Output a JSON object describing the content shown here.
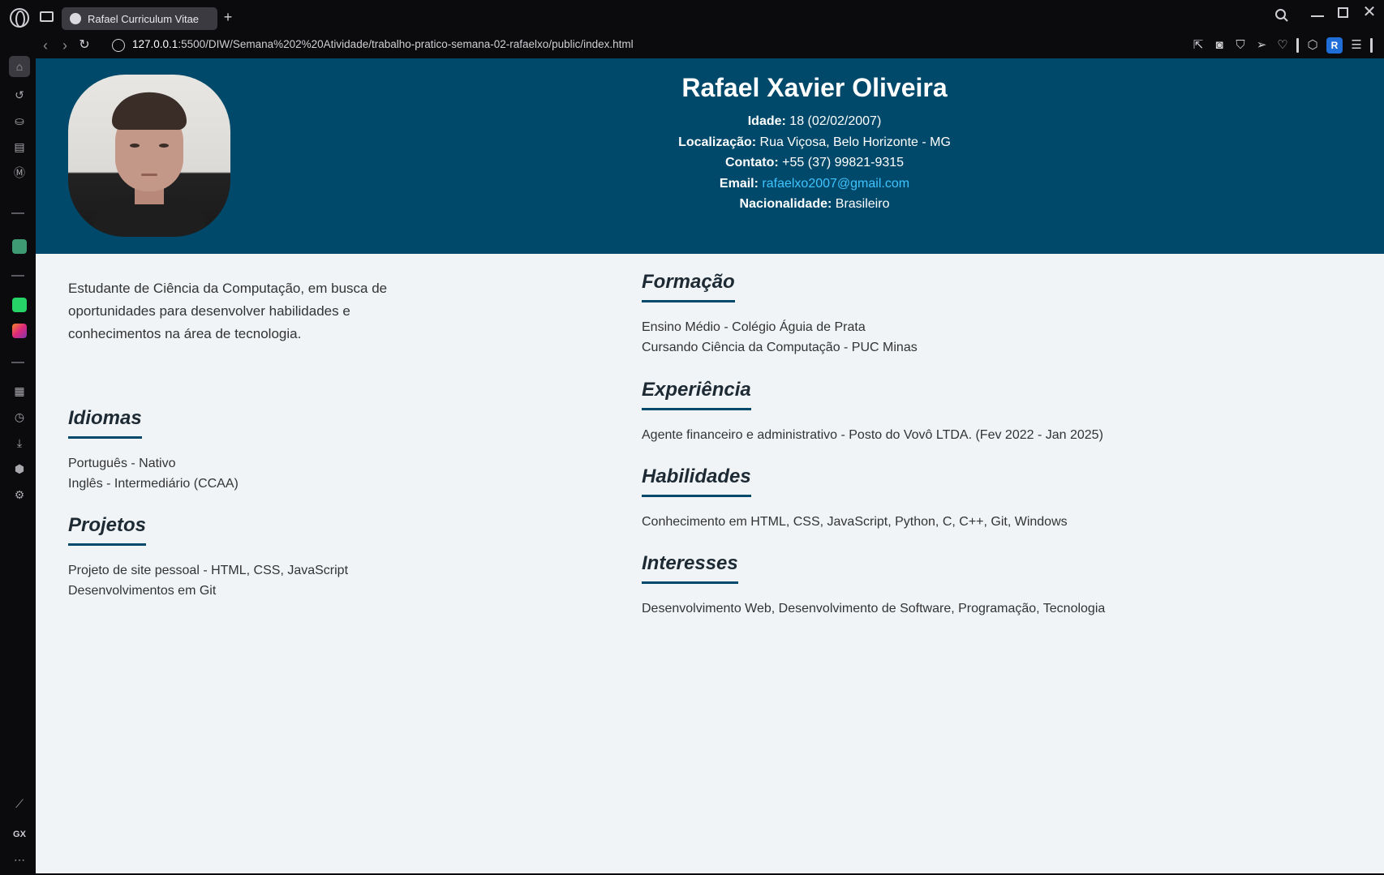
{
  "browser": {
    "tab_title": "Rafael Curriculum Vitae",
    "url_host": "127.0.0.1",
    "url_path": ":5500/DIW/Semana%202%20Atividade/trabalho-pratico-semana-02-rafaelxo/public/index.html",
    "profile_initial": "R",
    "sidebar_gx": "GX"
  },
  "header": {
    "name": "Rafael Xavier Oliveira",
    "age_label": "Idade:",
    "age_value": " 18 (02/02/2007)",
    "location_label": "Localização:",
    "location_value": " Rua Viçosa, Belo Horizonte - MG",
    "contact_label": "Contato:",
    "contact_value": " +55 (37) 99821-9315",
    "email_label": "Email:",
    "email_value": "rafaelxo2007@gmail.com",
    "nationality_label": "Nacionalidade:",
    "nationality_value": " Brasileiro"
  },
  "intro": "Estudante de Ciência da Computação, em busca de oportunidades para desenvolver habilidades e conhecimentos na área de tecnologia.",
  "sections": {
    "idiomas": {
      "title": "Idiomas",
      "lines": [
        "Português - Nativo",
        "Inglês - Intermediário (CCAA)"
      ]
    },
    "projetos": {
      "title": "Projetos",
      "lines": [
        "Projeto de site pessoal - HTML, CSS, JavaScript",
        "Desenvolvimentos em Git"
      ]
    },
    "formacao": {
      "title": "Formação",
      "lines": [
        "Ensino Médio - Colégio Águia de Prata",
        "Cursando Ciência da Computação - PUC Minas"
      ]
    },
    "experiencia": {
      "title": "Experiência",
      "lines": [
        "Agente financeiro e administrativo - Posto do Vovô LTDA. (Fev 2022 - Jan 2025)"
      ]
    },
    "habilidades": {
      "title": "Habilidades",
      "lines": [
        "Conhecimento em HTML, CSS, JavaScript, Python, C, C++, Git, Windows"
      ]
    },
    "interesses": {
      "title": "Interesses",
      "lines": [
        "Desenvolvimento Web, Desenvolvimento de Software, Programação, Tecnologia"
      ]
    }
  },
  "colors": {
    "header_bg": "#00496a",
    "accent": "#00496a",
    "link": "#3ec4ff",
    "page_bg": "#f0f4f7"
  }
}
